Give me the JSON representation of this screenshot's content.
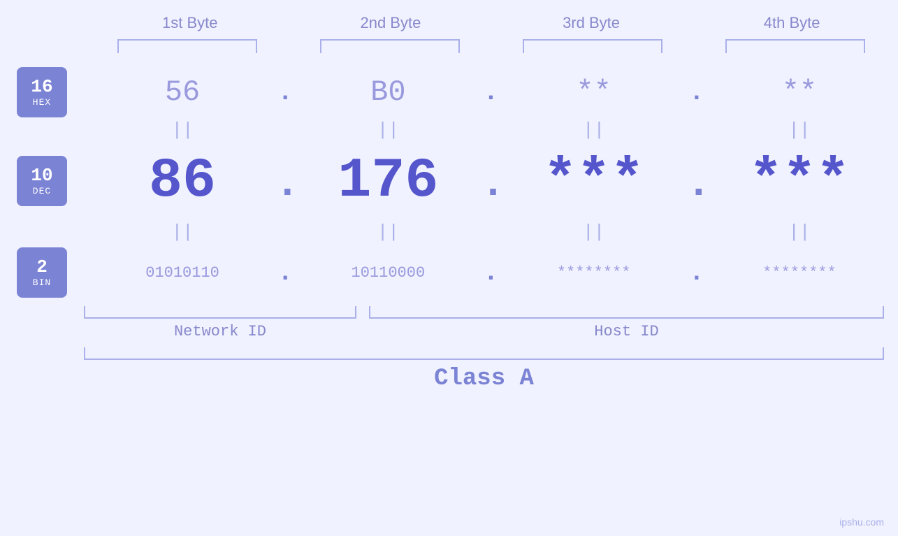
{
  "headers": {
    "byte1": "1st Byte",
    "byte2": "2nd Byte",
    "byte3": "3rd Byte",
    "byte4": "4th Byte"
  },
  "badges": {
    "hex": {
      "num": "16",
      "label": "HEX"
    },
    "dec": {
      "num": "10",
      "label": "DEC"
    },
    "bin": {
      "num": "2",
      "label": "BIN"
    }
  },
  "values": {
    "hex": {
      "b1": "56",
      "b2": "B0",
      "b3": "**",
      "b4": "**"
    },
    "dec": {
      "b1": "86",
      "b2": "176",
      "b3": "***",
      "b4": "***"
    },
    "bin": {
      "b1": "01010110",
      "b2": "10110000",
      "b3": "********",
      "b4": "********"
    }
  },
  "dots": ".",
  "eq": "||",
  "labels": {
    "network_id": "Network ID",
    "host_id": "Host ID",
    "class": "Class A"
  },
  "watermark": "ipshu.com"
}
